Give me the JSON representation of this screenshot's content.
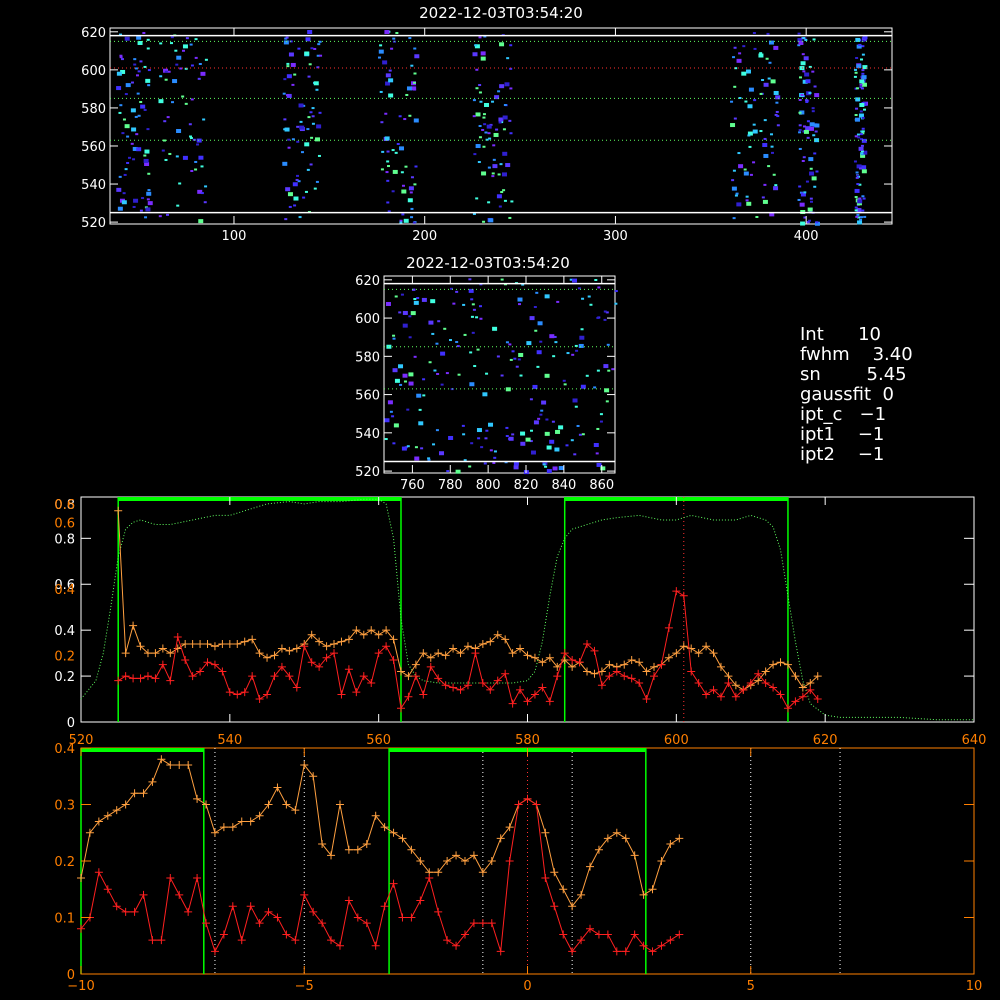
{
  "colors": {
    "background": "#000000",
    "axis_white": "#ffffff",
    "axis_orange": "#ff7f00",
    "series_red": "#ff2020",
    "series_orange": "#ffa040",
    "window_green": "#00ff00",
    "dotted_green": "#60ff60",
    "dotted_red": "#ff3030",
    "dotted_white": "#ffffff"
  },
  "info_box": {
    "lines": [
      "Int      10",
      "fwhm    3.40",
      "sn        5.45",
      "gaussfit  0",
      "ipt_c   −1",
      "ipt1    −1",
      "ipt2    −1"
    ]
  },
  "chart_data": [
    {
      "type": "heatmap",
      "title": "2022-12-03T03:54:20",
      "xlim": [
        35,
        445
      ],
      "ylim": [
        519,
        622
      ],
      "xticks": [
        100,
        200,
        300,
        400
      ],
      "yticks": [
        520,
        540,
        560,
        580,
        600,
        620
      ],
      "hlines": [
        {
          "y": 618,
          "style": "solid"
        },
        {
          "y": 525,
          "style": "solid"
        }
      ],
      "dotted_hlines": [
        {
          "y": 615,
          "color": "green"
        },
        {
          "y": 601,
          "color": "red"
        },
        {
          "y": 585,
          "color": "green"
        },
        {
          "y": 563,
          "color": "green"
        }
      ],
      "bands_x": [
        [
          38,
          55
        ],
        [
          60,
          85
        ],
        [
          125,
          145
        ],
        [
          175,
          195
        ],
        [
          225,
          245
        ],
        [
          360,
          385
        ],
        [
          395,
          405
        ],
        [
          425,
          430
        ]
      ]
    },
    {
      "type": "heatmap",
      "title": "2022-12-03T03:54:20",
      "xlim": [
        745,
        867
      ],
      "ylim": [
        519,
        622
      ],
      "xticks": [
        760,
        780,
        800,
        820,
        840,
        860
      ],
      "yticks": [
        520,
        540,
        560,
        580,
        600,
        620
      ],
      "hlines": [
        {
          "y": 618,
          "style": "solid"
        },
        {
          "y": 525,
          "style": "solid"
        }
      ],
      "dotted_hlines": [
        {
          "y": 615,
          "color": "green"
        },
        {
          "y": 585,
          "color": "green"
        },
        {
          "y": 563,
          "color": "green"
        }
      ]
    },
    {
      "type": "line",
      "xlim": [
        520,
        640
      ],
      "ylim": [
        0,
        0.98
      ],
      "xticks": [
        520,
        540,
        560,
        580,
        600,
        620,
        640
      ],
      "yticks_left_white": [
        0.0,
        0.2,
        0.4,
        0.6,
        0.8
      ],
      "yticks_left_orange": [
        0.2,
        0.4,
        0.6
      ],
      "ytick_label_overlap_top": "0.8",
      "ytick_label_overlap_top_orange": "0.6",
      "windows": [
        [
          525,
          563
        ],
        [
          585,
          615
        ]
      ],
      "dotted_vline": 601,
      "series": [
        {
          "color": "orange",
          "x": [
            525,
            526,
            527,
            528,
            529,
            530,
            531,
            532,
            533,
            534,
            535,
            536,
            537,
            538,
            539,
            540,
            541,
            542,
            543,
            544,
            545,
            546,
            547,
            548,
            549,
            550,
            551,
            552,
            553,
            554,
            555,
            556,
            557,
            558,
            559,
            560,
            561,
            562,
            563,
            564,
            565,
            566,
            567,
            568,
            569,
            570,
            571,
            572,
            573,
            574,
            575,
            576,
            577,
            578,
            579,
            580,
            581,
            582,
            583,
            584,
            585,
            586,
            587,
            588,
            589,
            590,
            591,
            592,
            593,
            594,
            595,
            596,
            597,
            598,
            599,
            600,
            601,
            602,
            603,
            604,
            605,
            606,
            607,
            608,
            609,
            610,
            611,
            612,
            613,
            614,
            615,
            616,
            617,
            618,
            619
          ],
          "y": [
            0.92,
            0.3,
            0.42,
            0.33,
            0.3,
            0.3,
            0.32,
            0.3,
            0.32,
            0.34,
            0.34,
            0.34,
            0.34,
            0.33,
            0.34,
            0.34,
            0.34,
            0.35,
            0.36,
            0.3,
            0.28,
            0.29,
            0.32,
            0.31,
            0.32,
            0.34,
            0.38,
            0.35,
            0.33,
            0.34,
            0.35,
            0.36,
            0.4,
            0.38,
            0.4,
            0.38,
            0.4,
            0.36,
            0.22,
            0.2,
            0.25,
            0.3,
            0.28,
            0.3,
            0.29,
            0.32,
            0.3,
            0.33,
            0.32,
            0.34,
            0.35,
            0.38,
            0.36,
            0.3,
            0.32,
            0.29,
            0.28,
            0.26,
            0.28,
            0.24,
            0.27,
            0.24,
            0.26,
            0.22,
            0.21,
            0.22,
            0.25,
            0.24,
            0.25,
            0.27,
            0.26,
            0.22,
            0.24,
            0.25,
            0.28,
            0.3,
            0.33,
            0.32,
            0.3,
            0.33,
            0.3,
            0.24,
            0.2,
            0.16,
            0.14,
            0.16,
            0.18,
            0.22,
            0.25,
            0.26,
            0.25,
            0.2,
            0.15,
            0.17,
            0.2
          ]
        },
        {
          "color": "red",
          "x": [
            525,
            526,
            527,
            528,
            529,
            530,
            531,
            532,
            533,
            534,
            535,
            536,
            537,
            538,
            539,
            540,
            541,
            542,
            543,
            544,
            545,
            546,
            547,
            548,
            549,
            550,
            551,
            552,
            553,
            554,
            555,
            556,
            557,
            558,
            559,
            560,
            561,
            562,
            563,
            564,
            565,
            566,
            567,
            568,
            569,
            570,
            571,
            572,
            573,
            574,
            575,
            576,
            577,
            578,
            579,
            580,
            581,
            582,
            583,
            584,
            585,
            586,
            587,
            588,
            589,
            590,
            591,
            592,
            593,
            594,
            595,
            596,
            597,
            598,
            599,
            600,
            601,
            602,
            603,
            604,
            605,
            606,
            607,
            608,
            609,
            610,
            611,
            612,
            613,
            614,
            615,
            616,
            617,
            618,
            619
          ],
          "y": [
            0.18,
            0.2,
            0.19,
            0.19,
            0.2,
            0.19,
            0.25,
            0.18,
            0.37,
            0.27,
            0.2,
            0.22,
            0.26,
            0.25,
            0.22,
            0.13,
            0.12,
            0.13,
            0.2,
            0.1,
            0.12,
            0.2,
            0.24,
            0.2,
            0.15,
            0.33,
            0.26,
            0.24,
            0.28,
            0.3,
            0.12,
            0.23,
            0.13,
            0.2,
            0.17,
            0.3,
            0.33,
            0.27,
            0.06,
            0.11,
            0.2,
            0.12,
            0.24,
            0.19,
            0.16,
            0.15,
            0.14,
            0.16,
            0.3,
            0.17,
            0.14,
            0.18,
            0.21,
            0.08,
            0.14,
            0.09,
            0.12,
            0.15,
            0.09,
            0.2,
            0.3,
            0.27,
            0.26,
            0.34,
            0.31,
            0.16,
            0.2,
            0.22,
            0.2,
            0.19,
            0.17,
            0.1,
            0.2,
            0.25,
            0.41,
            0.57,
            0.55,
            0.22,
            0.17,
            0.12,
            0.14,
            0.11,
            0.17,
            0.11,
            0.14,
            0.17,
            0.21,
            0.17,
            0.15,
            0.12,
            0.06,
            0.09,
            0.11,
            0.14,
            0.1
          ]
        },
        {
          "color": "dotted_green",
          "x": [
            520,
            522,
            523,
            524,
            525,
            526,
            527,
            528,
            530,
            532,
            535,
            538,
            540,
            542,
            545,
            548,
            550,
            552,
            555,
            558,
            560,
            561,
            562,
            563,
            564,
            565,
            566,
            568,
            570,
            572,
            575,
            578,
            580,
            581,
            582,
            583,
            584,
            585,
            586,
            588,
            590,
            592,
            595,
            598,
            600,
            602,
            605,
            608,
            610,
            612,
            613,
            614,
            615,
            616,
            617,
            618,
            620,
            622,
            625,
            630,
            635,
            640
          ],
          "y": [
            0.1,
            0.18,
            0.3,
            0.5,
            0.72,
            0.84,
            0.87,
            0.88,
            0.86,
            0.86,
            0.88,
            0.9,
            0.9,
            0.92,
            0.95,
            0.96,
            0.95,
            0.96,
            0.96,
            0.97,
            0.97,
            0.95,
            0.8,
            0.45,
            0.25,
            0.2,
            0.18,
            0.17,
            0.17,
            0.17,
            0.17,
            0.17,
            0.18,
            0.22,
            0.35,
            0.55,
            0.72,
            0.8,
            0.84,
            0.86,
            0.88,
            0.89,
            0.9,
            0.88,
            0.88,
            0.9,
            0.88,
            0.88,
            0.9,
            0.88,
            0.85,
            0.75,
            0.55,
            0.35,
            0.18,
            0.08,
            0.03,
            0.02,
            0.02,
            0.02,
            0.01,
            0.01
          ]
        }
      ]
    },
    {
      "type": "line",
      "xlim": [
        -10,
        10
      ],
      "ylim": [
        0,
        0.4
      ],
      "xticks": [
        -10,
        -5,
        0,
        5,
        10
      ],
      "yticks": [
        0.0,
        0.1,
        0.2,
        0.3,
        0.4
      ],
      "windows": [
        [
          -10,
          -7.25
        ],
        [
          -3.1,
          2.65
        ]
      ],
      "dotted_vlines_white": [
        -7,
        -5,
        -1,
        1,
        5,
        7
      ],
      "dotted_vline_red": 0,
      "series": [
        {
          "color": "orange",
          "x": [
            -10,
            -9.8,
            -9.6,
            -9.4,
            -9.2,
            -9.0,
            -8.8,
            -8.6,
            -8.4,
            -8.2,
            -8.0,
            -7.8,
            -7.6,
            -7.4,
            -7.2,
            -7.0,
            -6.8,
            -6.6,
            -6.4,
            -6.2,
            -6.0,
            -5.8,
            -5.6,
            -5.4,
            -5.2,
            -5.0,
            -4.8,
            -4.6,
            -4.4,
            -4.2,
            -4.0,
            -3.8,
            -3.6,
            -3.4,
            -3.2,
            -3.0,
            -2.8,
            -2.6,
            -2.4,
            -2.2,
            -2.0,
            -1.8,
            -1.6,
            -1.4,
            -1.2,
            -1.0,
            -0.8,
            -0.6,
            -0.4,
            -0.2,
            0.0,
            0.2,
            0.4,
            0.6,
            0.8,
            1.0,
            1.2,
            1.4,
            1.6,
            1.8,
            2.0,
            2.2,
            2.4,
            2.6,
            2.8,
            3.0,
            3.2,
            3.4
          ],
          "y": [
            0.17,
            0.25,
            0.27,
            0.28,
            0.29,
            0.3,
            0.32,
            0.32,
            0.34,
            0.38,
            0.37,
            0.37,
            0.37,
            0.31,
            0.3,
            0.25,
            0.26,
            0.26,
            0.27,
            0.27,
            0.28,
            0.3,
            0.33,
            0.3,
            0.29,
            0.37,
            0.35,
            0.23,
            0.21,
            0.3,
            0.22,
            0.22,
            0.23,
            0.28,
            0.26,
            0.25,
            0.24,
            0.22,
            0.2,
            0.18,
            0.18,
            0.2,
            0.21,
            0.2,
            0.21,
            0.18,
            0.2,
            0.24,
            0.26,
            0.3,
            0.31,
            0.3,
            0.25,
            0.18,
            0.15,
            0.12,
            0.14,
            0.19,
            0.22,
            0.24,
            0.25,
            0.24,
            0.21,
            0.14,
            0.15,
            0.2,
            0.23,
            0.24
          ]
        },
        {
          "color": "red",
          "x": [
            -10,
            -9.8,
            -9.6,
            -9.4,
            -9.2,
            -9.0,
            -8.8,
            -8.6,
            -8.4,
            -8.2,
            -8.0,
            -7.8,
            -7.6,
            -7.4,
            -7.2,
            -7.0,
            -6.8,
            -6.6,
            -6.4,
            -6.2,
            -6.0,
            -5.8,
            -5.6,
            -5.4,
            -5.2,
            -5.0,
            -4.8,
            -4.6,
            -4.4,
            -4.2,
            -4.0,
            -3.8,
            -3.6,
            -3.4,
            -3.2,
            -3.0,
            -2.8,
            -2.6,
            -2.4,
            -2.2,
            -2.0,
            -1.8,
            -1.6,
            -1.4,
            -1.2,
            -1.0,
            -0.8,
            -0.6,
            -0.4,
            -0.2,
            0.0,
            0.2,
            0.4,
            0.6,
            0.8,
            1.0,
            1.2,
            1.4,
            1.6,
            1.8,
            2.0,
            2.2,
            2.4,
            2.6,
            2.8,
            3.0,
            3.2,
            3.4
          ],
          "y": [
            0.08,
            0.1,
            0.18,
            0.15,
            0.12,
            0.11,
            0.11,
            0.14,
            0.06,
            0.06,
            0.17,
            0.14,
            0.11,
            0.17,
            0.09,
            0.04,
            0.07,
            0.12,
            0.06,
            0.12,
            0.09,
            0.11,
            0.1,
            0.07,
            0.06,
            0.14,
            0.11,
            0.09,
            0.06,
            0.05,
            0.13,
            0.1,
            0.09,
            0.05,
            0.12,
            0.16,
            0.1,
            0.1,
            0.13,
            0.17,
            0.11,
            0.06,
            0.05,
            0.07,
            0.09,
            0.09,
            0.09,
            0.04,
            0.2,
            0.3,
            0.31,
            0.3,
            0.17,
            0.12,
            0.07,
            0.04,
            0.06,
            0.08,
            0.07,
            0.07,
            0.04,
            0.04,
            0.07,
            0.05,
            0.04,
            0.05,
            0.06,
            0.07
          ]
        }
      ]
    }
  ]
}
